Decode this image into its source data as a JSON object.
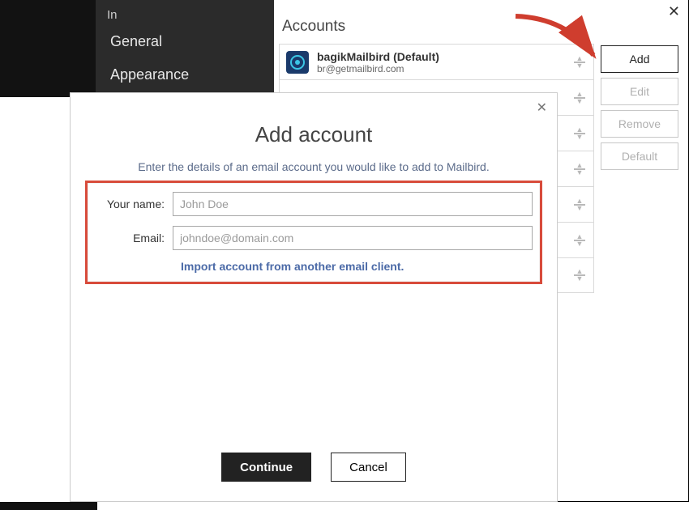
{
  "sidebar": {
    "truncated_text": "In",
    "items": [
      "General",
      "Appearance"
    ]
  },
  "main": {
    "heading": "Accounts",
    "account": {
      "name": "bagikMailbird (Default)",
      "email": "br@getmailbird.com"
    },
    "buttons": {
      "add": "Add",
      "edit": "Edit",
      "remove": "Remove",
      "default": "Default"
    }
  },
  "modal": {
    "title": "Add account",
    "subtitle": "Enter the details of an email account you would like to add to Mailbird.",
    "labels": {
      "name": "Your name:",
      "email": "Email:"
    },
    "placeholders": {
      "name": "John Doe",
      "email": "johndoe@domain.com"
    },
    "import_link": "Import account from another email client.",
    "continue": "Continue",
    "cancel": "Cancel"
  },
  "colors": {
    "highlight": "#d84b3b",
    "arrow": "#cf3d2e",
    "link": "#4b6aa7"
  }
}
